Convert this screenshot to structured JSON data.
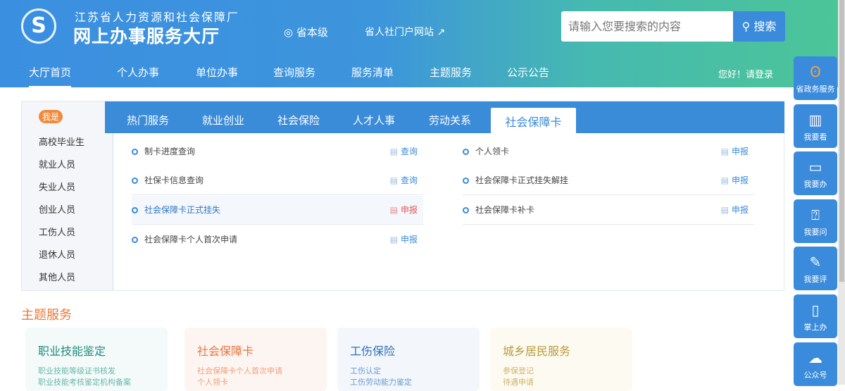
{
  "header": {
    "logo_text": "S",
    "org": "江苏省人力资源和社会保障厂",
    "title": "网上办事服务大厅",
    "location": "省本级",
    "portal": "省人社门户网站",
    "search_placeholder": "请输入您要搜索的内容",
    "search_button": "搜索",
    "login": "您好！请登录"
  },
  "nav": [
    "大厅首页",
    "个人办事",
    "单位办事",
    "查询服务",
    "服务清单",
    "主题服务",
    "公示公告"
  ],
  "sidebar": {
    "badge": "我是",
    "items": [
      "高校毕业生",
      "就业人员",
      "失业人员",
      "创业人员",
      "工伤人员",
      "退休人员",
      "其他人员"
    ]
  },
  "tabs": [
    "热门服务",
    "就业创业",
    "社会保险",
    "人才人事",
    "劳动关系",
    "社会保障卡"
  ],
  "services_left": [
    {
      "name": "制卡进度查询",
      "action": "查询"
    },
    {
      "name": "社保卡信息查询",
      "action": "查询"
    },
    {
      "name": "社会保障卡正式挂失",
      "action": "申报"
    },
    {
      "name": "社会保障卡个人首次申请",
      "action": "申报"
    }
  ],
  "services_right": [
    {
      "name": "个人领卡",
      "action": "申报"
    },
    {
      "name": "社会保障卡正式挂失解挂",
      "action": "申报"
    },
    {
      "name": "社会保障卡补卡",
      "action": "申报"
    }
  ],
  "theme": {
    "title": "主题服务",
    "cards": [
      {
        "title": "职业技能鉴定",
        "lines": [
          "职业技能等级证书核发",
          "职业技能考核鉴定机构备案"
        ]
      },
      {
        "title": "社会保障卡",
        "lines": [
          "社会保障卡个人首次申请",
          "个人领卡"
        ]
      },
      {
        "title": "工伤保险",
        "lines": [
          "工伤认定",
          "工伤劳动能力鉴定"
        ]
      },
      {
        "title": "城乡居民服务",
        "lines": [
          "参保登记",
          "待遇申请"
        ]
      }
    ]
  },
  "float": [
    "省政务服务",
    "我要看",
    "我要办",
    "我要问",
    "我要评",
    "掌上办",
    "公众号"
  ]
}
